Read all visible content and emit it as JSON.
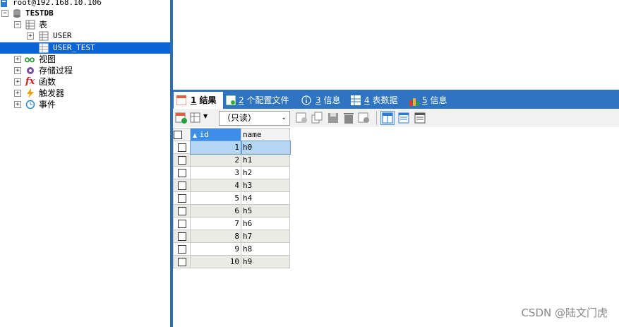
{
  "tree": {
    "connection": "root@192.168.10.106",
    "database": "TESTDB",
    "tables_folder": "表",
    "tables": [
      "USER",
      "USER_TEST"
    ],
    "views": "视图",
    "procedures": "存储过程",
    "functions": "函数",
    "triggers": "触发器",
    "events": "事件"
  },
  "tabs": [
    {
      "num": "1",
      "label": "结果"
    },
    {
      "num": "2",
      "label": "个配置文件"
    },
    {
      "num": "3",
      "label": "信息"
    },
    {
      "num": "4",
      "label": "表数据"
    },
    {
      "num": "5",
      "label": "信息"
    }
  ],
  "toolbar": {
    "mode": "（只读）"
  },
  "grid": {
    "columns": [
      "id",
      "name"
    ],
    "rows": [
      [
        "1",
        "h0"
      ],
      [
        "2",
        "h1"
      ],
      [
        "3",
        "h2"
      ],
      [
        "4",
        "h3"
      ],
      [
        "5",
        "h4"
      ],
      [
        "6",
        "h5"
      ],
      [
        "7",
        "h6"
      ],
      [
        "8",
        "h7"
      ],
      [
        "9",
        "h8"
      ],
      [
        "10",
        "h9"
      ]
    ]
  },
  "watermark": "CSDN @陆文门虎",
  "colors": {
    "accent": "#2f74c0",
    "selection": "#0a64d6"
  }
}
